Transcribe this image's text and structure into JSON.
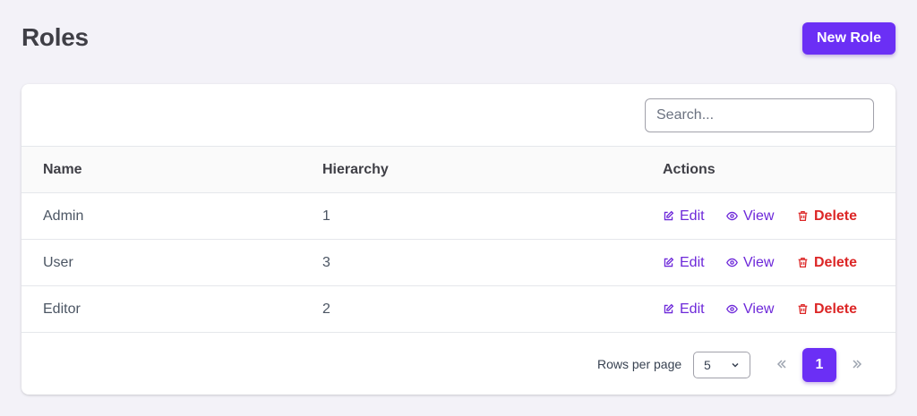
{
  "header": {
    "title": "Roles",
    "new_button_label": "New Role"
  },
  "search": {
    "placeholder": "Search..."
  },
  "table": {
    "columns": [
      "Name",
      "Hierarchy",
      "Actions"
    ],
    "rows": [
      {
        "name": "Admin",
        "hierarchy": "1"
      },
      {
        "name": "User",
        "hierarchy": "3"
      },
      {
        "name": "Editor",
        "hierarchy": "2"
      }
    ],
    "actions": {
      "edit": "Edit",
      "view": "View",
      "delete": "Delete"
    }
  },
  "pagination": {
    "rows_per_page_label": "Rows per page",
    "rows_per_page_value": "5",
    "current_page": "1"
  },
  "colors": {
    "accent": "#6b2ff5",
    "danger": "#dc2626",
    "background": "#f3f2f8"
  },
  "icons": {
    "edit": "pencil-square-icon",
    "view": "eye-icon",
    "delete": "trash-icon",
    "first": "chevrons-left-icon",
    "last": "chevrons-right-icon",
    "select": "chevron-down-icon"
  }
}
